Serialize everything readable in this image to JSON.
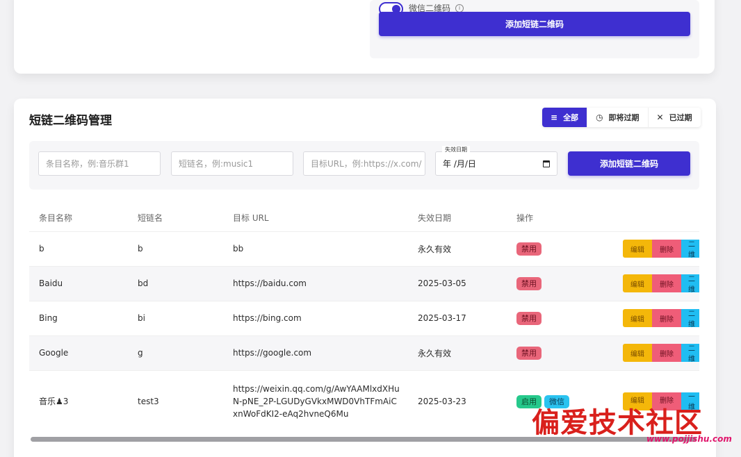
{
  "top_form": {
    "wechat_toggle": {
      "label": "微信二维码",
      "on": true
    },
    "info_icon": "i",
    "add_button": "添加短链二维码"
  },
  "management": {
    "title": "短链二维码管理",
    "filters": [
      {
        "label": "全部",
        "icon": "≡",
        "active": true
      },
      {
        "label": "即将过期",
        "icon": "◷",
        "active": false
      },
      {
        "label": "已过期",
        "icon": "✕",
        "active": false
      }
    ],
    "form": {
      "name_placeholder": "条目名称，例:音乐群1",
      "short_placeholder": "短链名，例:music1",
      "url_placeholder": "目标URL，例:https://x.com/",
      "date_label": "失效日期",
      "date_value": "年 /月/日",
      "add_button": "添加短链二维码"
    },
    "table": {
      "headers": [
        "条目名称",
        "短链名",
        "目标 URL",
        "失效日期",
        "操作"
      ],
      "rows": [
        {
          "name": "b",
          "short": "b",
          "url": "bb",
          "expiry": "永久有效",
          "status": "禁用",
          "wechat": ""
        },
        {
          "name": "Baidu",
          "short": "bd",
          "url": "https://baidu.com",
          "expiry": "2025-03-05",
          "status": "禁用",
          "wechat": ""
        },
        {
          "name": "Bing",
          "short": "bi",
          "url": "https://bing.com",
          "expiry": "2025-03-17",
          "status": "禁用",
          "wechat": ""
        },
        {
          "name": "Google",
          "short": "g",
          "url": "https://google.com",
          "expiry": "永久有效",
          "status": "禁用",
          "wechat": ""
        },
        {
          "name": "音乐♟3",
          "short": "test3",
          "url": "https://weixin.qq.com/g/AwYAAMlxdXHuN-pNE_2P-LGUDyGVkxMWD0VhTFmAiCxnWoFdKI2-eAq2hvneQ6Mu",
          "expiry": "2025-03-23",
          "status": "启用",
          "wechat": "微信"
        }
      ],
      "actions": {
        "edit": "编辑",
        "delete": "删除",
        "qr": "二维"
      }
    }
  },
  "watermark": {
    "text": "偏爱技术社区",
    "url": "www.pojjishu.com"
  },
  "colors": {
    "primary": "#3e2fd0",
    "danger": "#e9667a",
    "success": "#26c98c",
    "warning": "#f4b70a",
    "info": "#20bdf2"
  }
}
